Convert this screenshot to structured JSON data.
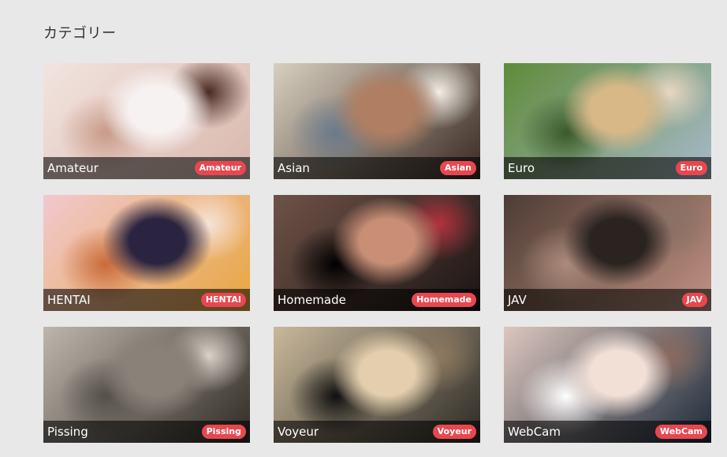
{
  "section": {
    "title": "カテゴリー"
  },
  "categories": [
    {
      "label": "Amateur",
      "tag": "Amateur",
      "thumb_icon": "amateur-thumbnail",
      "palette": [
        "#f2e4df",
        "#d9b8ad",
        "#f7f2f2",
        "#4a2a22",
        "#c99b8a"
      ]
    },
    {
      "label": "Asian",
      "tag": "Asian",
      "thumb_icon": "asian-thumbnail",
      "palette": [
        "#d8cfc0",
        "#3a2a22",
        "#b07e62",
        "#f2eee6",
        "#6a7b8c"
      ]
    },
    {
      "label": "Euro",
      "tag": "Euro",
      "thumb_icon": "euro-thumbnail",
      "palette": [
        "#5f8b3a",
        "#a7b9c9",
        "#d9b888",
        "#e9d7c2",
        "#3b5a2b"
      ]
    },
    {
      "label": "HENTAI",
      "tag": "HENTAI",
      "thumb_icon": "hentai-thumbnail",
      "palette": [
        "#f1c8cf",
        "#e8a640",
        "#2a2440",
        "#f6e3d8",
        "#c96a3a"
      ]
    },
    {
      "label": "Homemade",
      "tag": "Homemade",
      "thumb_icon": "homemade-thumbnail",
      "palette": [
        "#6e5247",
        "#1b1414",
        "#c88f76",
        "#b3323d",
        "#000000"
      ]
    },
    {
      "label": "JAV",
      "tag": "JAV",
      "thumb_icon": "jav-thumbnail",
      "palette": [
        "#4d3c34",
        "#c09283",
        "#2a2320",
        "#8a7066",
        "#ab8a7c"
      ]
    },
    {
      "label": "Pissing",
      "tag": "Pissing",
      "thumb_icon": "pissing-thumbnail",
      "palette": [
        "#bdb6ac",
        "#2f2a24",
        "#8a8178",
        "#d8d2c8",
        "#55504a"
      ]
    },
    {
      "label": "Voyeur",
      "tag": "Voyeur",
      "thumb_icon": "voyeur-thumbnail",
      "palette": [
        "#c9b89a",
        "#2c2a25",
        "#e3cfad",
        "#8f7a60",
        "#111111"
      ]
    },
    {
      "label": "WebCam",
      "tag": "WebCam",
      "thumb_icon": "webcam-thumbnail",
      "palette": [
        "#dcc6bd",
        "#1d2a3a",
        "#f2e0d6",
        "#8a6a5e",
        "#ffffff"
      ]
    }
  ],
  "colors": {
    "background": "#e8e8e8",
    "badge": "#e8474f",
    "caption_bar": "rgba(0,0,0,0.58)",
    "title_text": "#333333"
  }
}
